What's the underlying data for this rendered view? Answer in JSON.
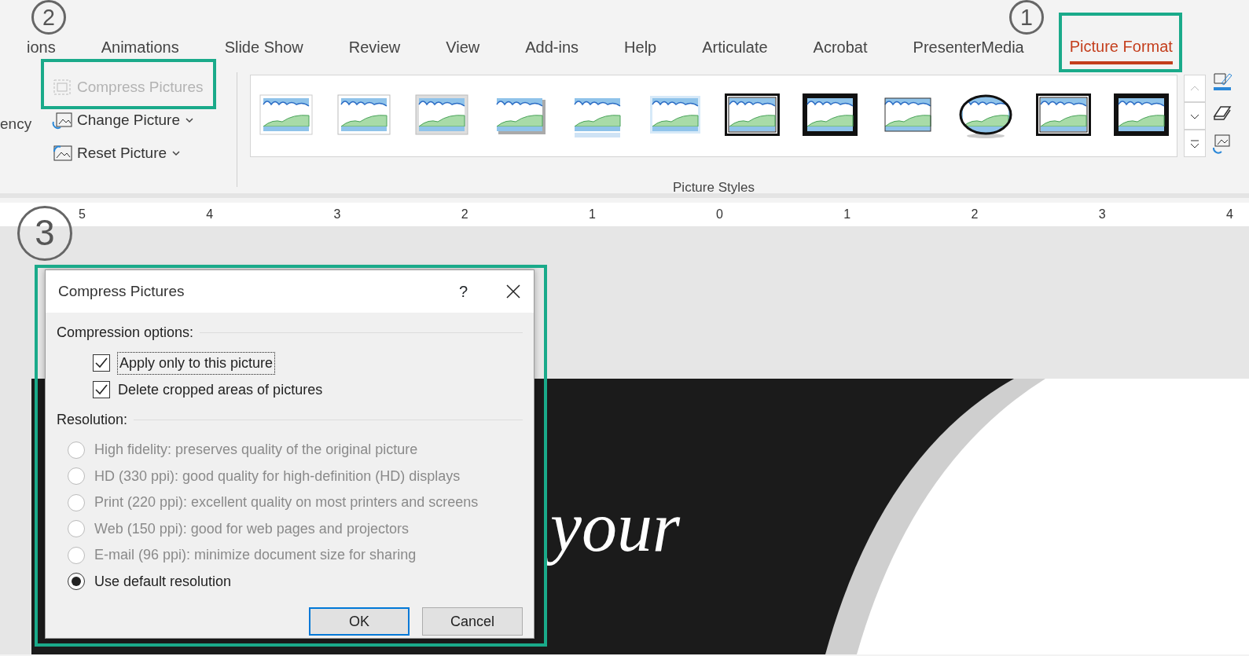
{
  "tabs": [
    {
      "label": "ions",
      "selected": false
    },
    {
      "label": "Animations",
      "selected": false
    },
    {
      "label": "Slide Show",
      "selected": false
    },
    {
      "label": "Review",
      "selected": false
    },
    {
      "label": "View",
      "selected": false
    },
    {
      "label": "Add-ins",
      "selected": false
    },
    {
      "label": "Help",
      "selected": false
    },
    {
      "label": "Articulate",
      "selected": false
    },
    {
      "label": "Acrobat",
      "selected": false
    },
    {
      "label": "PresenterMedia",
      "selected": false
    },
    {
      "label": "Picture Format",
      "selected": true
    }
  ],
  "ribbon": {
    "cut_label": "ency",
    "adjust_commands": [
      {
        "label": "Compress Pictures",
        "disabled": true,
        "dropdown": false
      },
      {
        "label": "Change Picture",
        "disabled": false,
        "dropdown": true
      },
      {
        "label": "Reset Picture",
        "disabled": false,
        "dropdown": true
      }
    ],
    "picture_styles": {
      "label": "Picture Styles",
      "styles": [
        {
          "kind": "simple-frame"
        },
        {
          "kind": "soft-frame"
        },
        {
          "kind": "gray-frame"
        },
        {
          "kind": "drop-shadow"
        },
        {
          "kind": "reflection"
        },
        {
          "kind": "soft-edge"
        },
        {
          "kind": "double-frame"
        },
        {
          "kind": "thick-frame"
        },
        {
          "kind": "plain"
        },
        {
          "kind": "oval"
        },
        {
          "kind": "double-frame"
        },
        {
          "kind": "thick-frame"
        }
      ]
    }
  },
  "ruler": {
    "labels": [
      "5",
      "4",
      "3",
      "2",
      "1",
      "0",
      "1",
      "2",
      "3",
      "4"
    ]
  },
  "slide": {
    "text": "your"
  },
  "annotations": [
    {
      "number": "1"
    },
    {
      "number": "2"
    },
    {
      "number": "3"
    }
  ],
  "dialog": {
    "title": "Compress Pictures",
    "help": "?",
    "compression": {
      "heading": "Compression options:",
      "options": [
        {
          "label": "Apply only to this picture",
          "checked": true,
          "focused": true
        },
        {
          "label": "Delete cropped areas of pictures",
          "checked": true,
          "focused": false
        }
      ]
    },
    "resolution": {
      "heading": "Resolution:",
      "options": [
        {
          "label": "High fidelity: preserves quality of the original picture",
          "selected": false,
          "disabled": true
        },
        {
          "label": "HD (330 ppi): good quality for high-definition (HD) displays",
          "selected": false,
          "disabled": true
        },
        {
          "label": "Print (220 ppi): excellent quality on most printers and screens",
          "selected": false,
          "disabled": true
        },
        {
          "label": "Web (150 ppi): good for web pages and projectors",
          "selected": false,
          "disabled": true
        },
        {
          "label": "E-mail (96 ppi): minimize document size for sharing",
          "selected": false,
          "disabled": true
        },
        {
          "label": "Use default resolution",
          "selected": true,
          "disabled": false
        }
      ]
    },
    "buttons": [
      {
        "label": "OK",
        "default": true
      },
      {
        "label": "Cancel",
        "default": false
      }
    ]
  }
}
